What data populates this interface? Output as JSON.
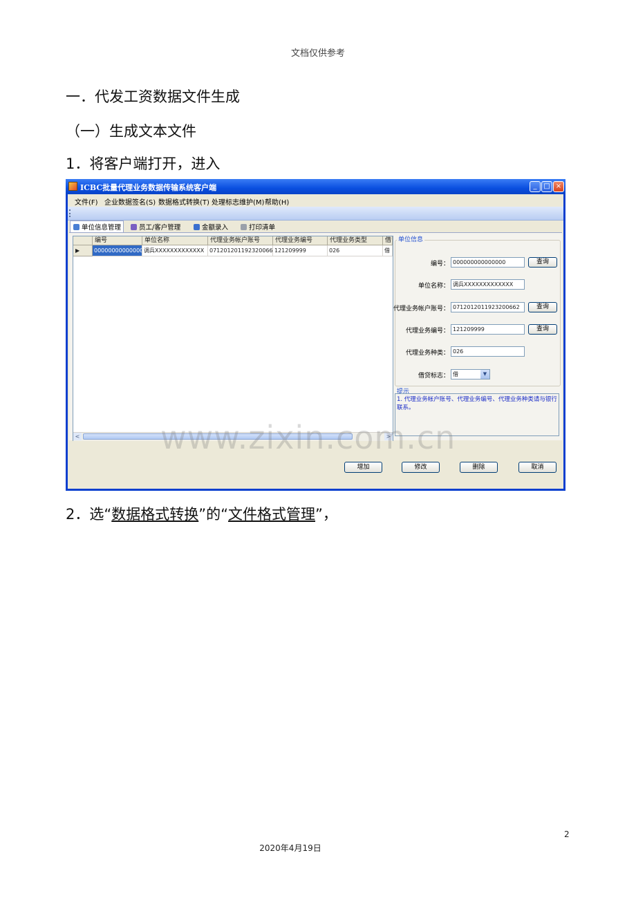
{
  "document": {
    "header_note": "文档仅供参考",
    "heading1": "一．代发工资数据文件生成",
    "heading2": "（一）生成文本文件",
    "step1": "1．将客户端打开，进入",
    "step2": {
      "prefix": "2．选“",
      "link1": "数据格式转换",
      "middle": "”的“",
      "link2": "文件格式管理",
      "suffix": "”，"
    },
    "page_number": "2",
    "footer_date": "2020年4月19日",
    "watermark": "www.zixin.com.cn"
  },
  "window": {
    "title": "ICBC批量代理业务数据传输系统客户端",
    "controls": {
      "minimize": "_",
      "maximize": "□",
      "close": "×"
    },
    "menu": [
      "文件(F)",
      "企业数据签名(S)",
      "数据格式转换(T)",
      "处理标志维护(M)",
      "帮助(H)"
    ],
    "tabs": [
      {
        "label": "单位信息管理",
        "icon": "unit-info-icon",
        "color": "#4a7fd4"
      },
      {
        "label": "员工/客户管理",
        "icon": "staff-icon",
        "color": "#7a5fc2"
      },
      {
        "label": "金额录入",
        "icon": "pen-icon",
        "color": "#3a6fcf"
      },
      {
        "label": "打印清单",
        "icon": "printer-icon",
        "color": "#9aa0aa"
      }
    ],
    "grid": {
      "columns": [
        "编号",
        "单位名称",
        "代理业务帐户账号",
        "代理业务编号",
        "代理业务类型",
        "借"
      ],
      "rows": [
        [
          "000000000000000",
          "调兵XXXXXXXXXXXXX",
          "0712012011923200662",
          "121209999",
          "026",
          "借"
        ]
      ],
      "row_marker": "▶",
      "scroll_left": "<",
      "scroll_right": ">"
    },
    "unit_info": {
      "title": "单位信息",
      "fields": {
        "code_label": "编号：",
        "code_value": "000000000000000",
        "name_label": "单位名称：",
        "name_value": "调兵XXXXXXXXXXXXX",
        "account_label": "代理业务帐户账号：",
        "account_value": "0712012011923200662",
        "biz_code_label": "代理业务编号：",
        "biz_code_value": "121209999",
        "biz_type_label": "代理业务种类：",
        "biz_type_value": "026",
        "debit_label": "借贷标志：",
        "debit_value": "借"
      },
      "query_label": "查询"
    },
    "hint": {
      "title": "提示",
      "text": "1. 代理业务帐户账号、代理业务编号、代理业务种类请与银行联系。"
    },
    "buttons": {
      "add": "增加",
      "modify": "修改",
      "delete": "删除",
      "cancel": "取消"
    }
  }
}
